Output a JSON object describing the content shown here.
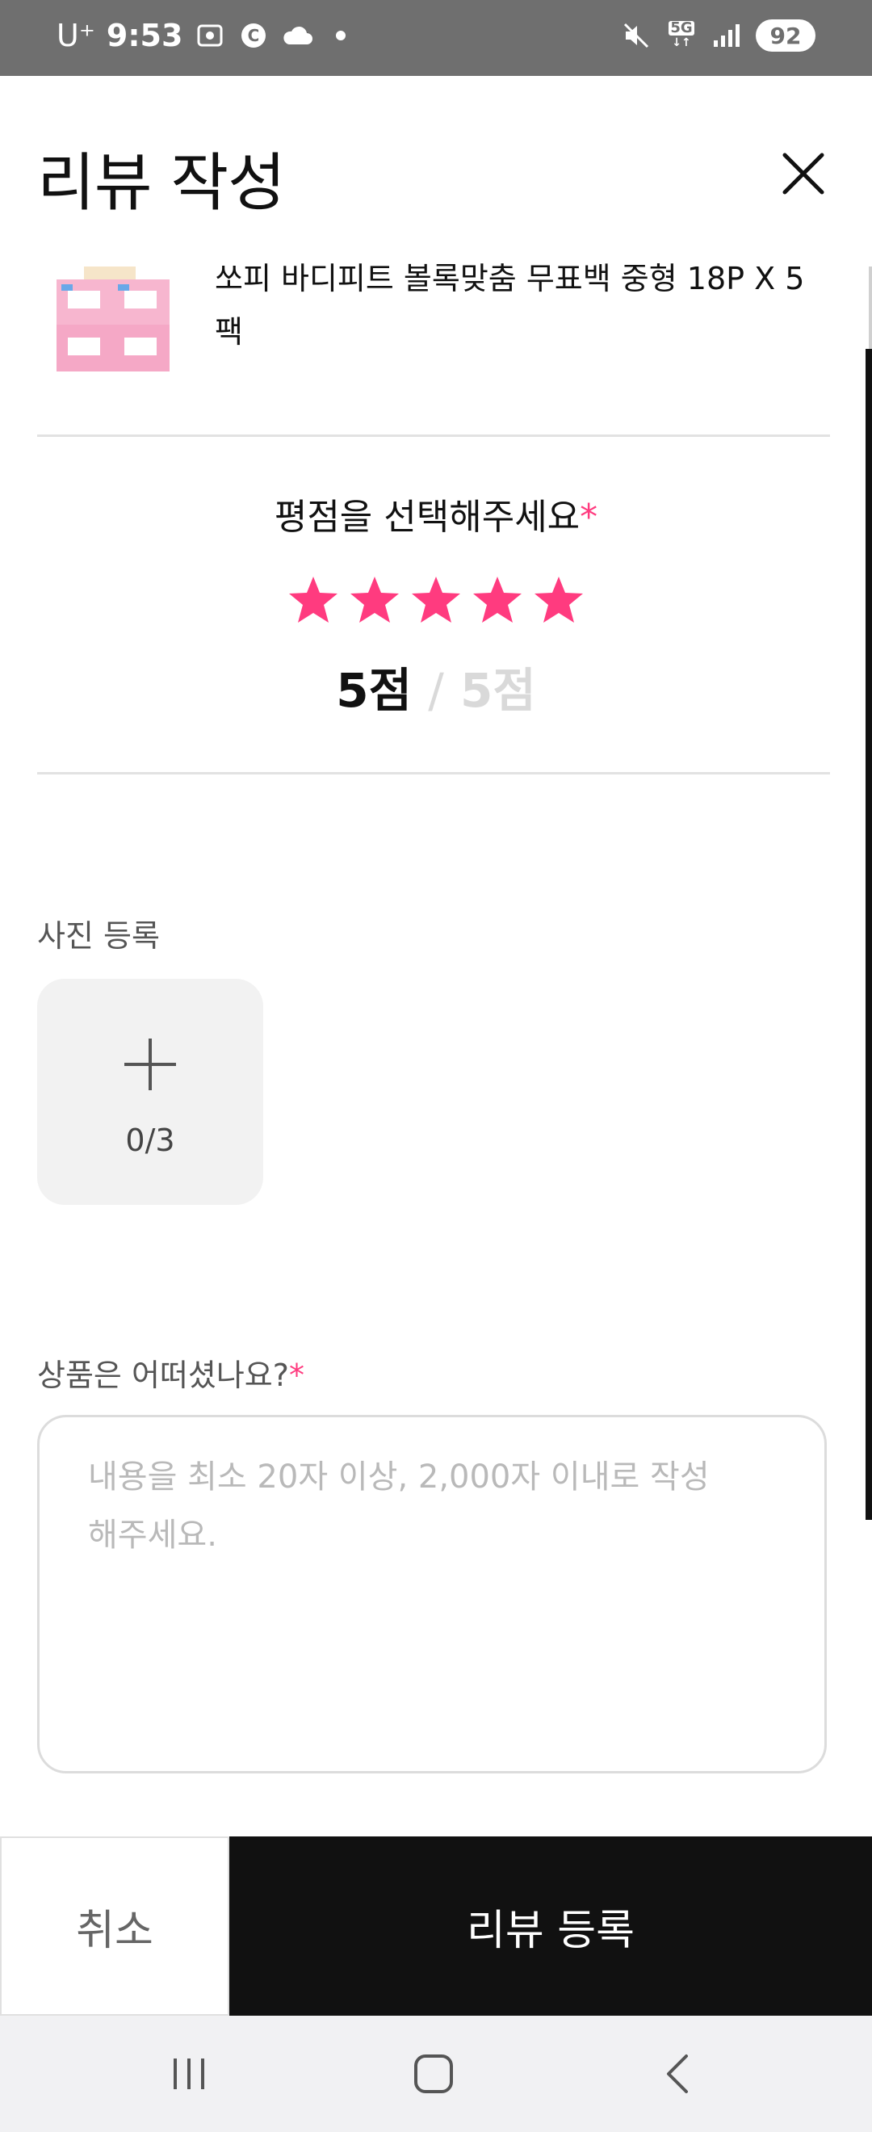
{
  "status_bar": {
    "carrier": "U⁺",
    "time": "9:53",
    "network": "5G",
    "battery": "92",
    "icons": [
      "screenshot-icon",
      "c-badge-icon",
      "cloud-icon",
      "dot-icon",
      "mute-icon",
      "5g-icon",
      "signal-icon",
      "battery-icon"
    ]
  },
  "header": {
    "title": "리뷰 작성",
    "close_icon": "close-icon"
  },
  "product": {
    "name": "쏘피 바디피트 볼록맞춤 무표백 중형 18P X 5팩",
    "thumbnail_icon": "product-thumbnail"
  },
  "rating": {
    "prompt": "평점을 선택해주세요",
    "required_mark": "*",
    "stars_selected": 5,
    "stars_total": 5,
    "score": "5점",
    "separator": "/",
    "max_score": "5점",
    "star_color": "#ff3b7f"
  },
  "photo": {
    "label": "사진 등록",
    "count": "0/3",
    "add_icon": "plus-icon"
  },
  "review": {
    "label": "상품은 어떠셨나요?",
    "required_mark": "*",
    "placeholder": "내용을 최소 20자 이상, 2,000자 이내로 작성해주세요."
  },
  "actions": {
    "cancel_label": "취소",
    "submit_label": "리뷰 등록"
  },
  "navbar": {
    "items": [
      "recent-apps-icon",
      "home-icon",
      "back-icon"
    ]
  }
}
